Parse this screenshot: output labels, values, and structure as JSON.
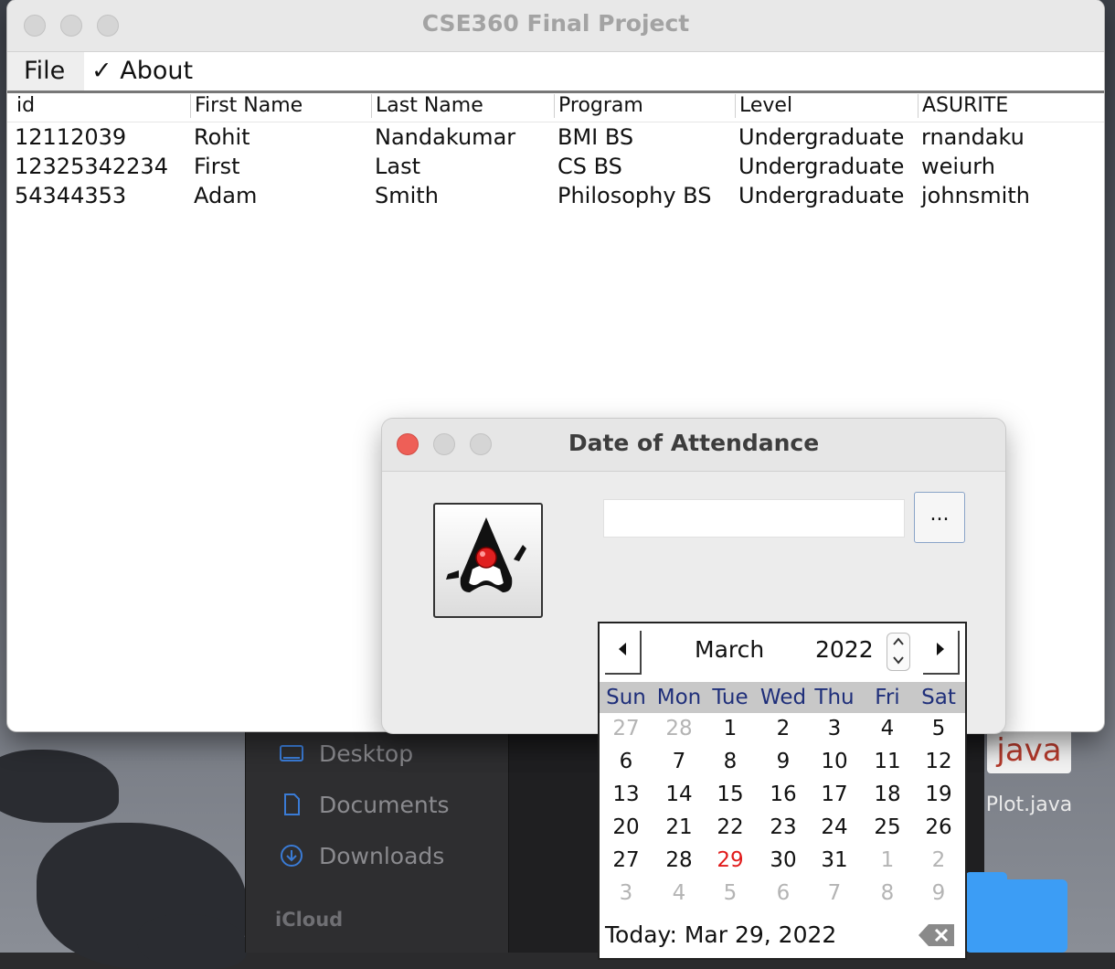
{
  "main_window": {
    "title": "CSE360 Final Project",
    "menu": {
      "file": "File",
      "about_check": "✓",
      "about": "About"
    },
    "table": {
      "columns": [
        "id",
        "First Name",
        "Last Name",
        "Program",
        "Level",
        "ASURITE"
      ],
      "rows": [
        [
          "12112039",
          "Rohit",
          "Nandakumar",
          "BMI BS",
          "Undergraduate",
          "rnandaku"
        ],
        [
          "12325342234",
          "First",
          "Last",
          "CS BS",
          "Undergraduate",
          "weiurh"
        ],
        [
          "54344353",
          "Adam",
          "Smith",
          "Philosophy BS",
          "Undergraduate",
          "johnsmith"
        ]
      ]
    }
  },
  "dialog": {
    "title": "Date of Attendance",
    "date_value": "",
    "picker_button": "..."
  },
  "calendar": {
    "month": "March",
    "year": "2022",
    "days_of_week": [
      "Sun",
      "Mon",
      "Tue",
      "Wed",
      "Thu",
      "Fri",
      "Sat"
    ],
    "weeks": [
      [
        "27",
        "28",
        "1",
        "2",
        "3",
        "4",
        "5"
      ],
      [
        "6",
        "7",
        "8",
        "9",
        "10",
        "11",
        "12"
      ],
      [
        "13",
        "14",
        "15",
        "16",
        "17",
        "18",
        "19"
      ],
      [
        "20",
        "21",
        "22",
        "23",
        "24",
        "25",
        "26"
      ],
      [
        "27",
        "28",
        "29",
        "30",
        "31",
        "1",
        "2"
      ],
      [
        "3",
        "4",
        "5",
        "6",
        "7",
        "8",
        "9"
      ]
    ],
    "today_label": "Today: Mar 29, 2022",
    "prev_icon": "caret-left-icon",
    "next_icon": "caret-right-icon"
  },
  "desktop": {
    "sidebar": [
      "Desktop",
      "Documents",
      "Downloads"
    ],
    "section": "iCloud",
    "file_icon_text": "java",
    "file_name": "Plot.java"
  },
  "colors": {
    "today_red": "#e11b1b",
    "weekday_blue": "#1f2f7a",
    "close_red": "#ee5f57"
  }
}
